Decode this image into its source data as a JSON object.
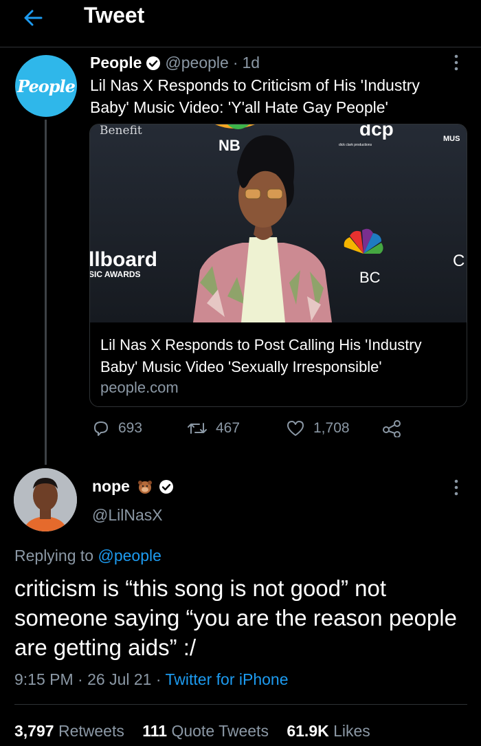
{
  "header": {
    "title": "Tweet"
  },
  "quoted_tweet": {
    "avatar_text": "People",
    "name": "People",
    "handle": "@people",
    "separator": "·",
    "time": "1d",
    "text": "Lil Nas X Responds to Criticism of His 'Industry Baby' Music Video: 'Y'all Hate Gay People'",
    "card": {
      "title": "Lil Nas X Responds to Post Calling His 'Industry Baby' Music Video 'Sexually Irresponsible'",
      "domain": "people.com",
      "backdrop_text": {
        "benefit": "Benefit",
        "nbc_partial": "NB",
        "dcp": "dcp",
        "dick_clark": "dick clark productions",
        "mus": "MUS",
        "billboard": "llboard",
        "music_awards": "SIC AWARDS",
        "bc": "BC",
        "c": "C"
      }
    },
    "stats": {
      "replies": "693",
      "retweets": "467",
      "likes": "1,708"
    }
  },
  "main_tweet": {
    "name": "nope",
    "handle": "@LilNasX",
    "replying_label": "Replying to",
    "replying_handle": "@people",
    "text": "criticism is “this song is not good” not someone saying “you are the reason people are getting aids” :/",
    "time": "9:15 PM",
    "date": "26 Jul 21",
    "sep1": "·",
    "sep2": "·",
    "source": "Twitter for iPhone",
    "retweets_count": "3,797",
    "retweets_label": "Retweets",
    "quotes_count": "111",
    "quotes_label": "Quote Tweets",
    "likes_count": "61.9K",
    "likes_label": "Likes"
  },
  "icons": [
    "back-arrow-icon",
    "verified-icon",
    "more-icon",
    "reply-icon",
    "retweet-icon",
    "like-icon",
    "share-icon",
    "emoji-icon"
  ],
  "colors": {
    "background": "#000000",
    "accent": "#1d9bf0",
    "muted": "#8b98a5",
    "people_brand": "#2fb7ea"
  }
}
